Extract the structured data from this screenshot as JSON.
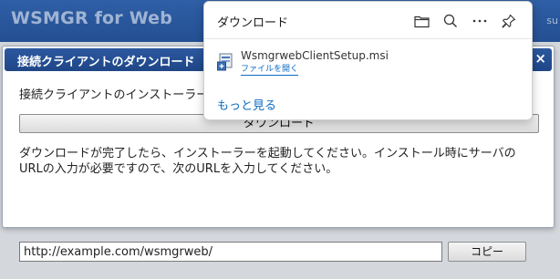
{
  "app": {
    "title": "WSMGR for Web",
    "header_right": "su"
  },
  "dialog": {
    "title": "接続クライアントのダウンロード",
    "close_glyph": "×",
    "intro": "接続クライアントのインストーラー",
    "download_label": "ダウンロード",
    "instruction": "ダウンロードが完了したら、インストーラーを起動してください。インストール時にサーバのURLの入力が必要ですので、次のURLを入力してください。",
    "url_value": "http://example.com/wsmgrweb/",
    "copy_label": "コピー"
  },
  "downloads": {
    "title": "ダウンロード",
    "icons": [
      "folder-icon",
      "search-icon",
      "more-icon",
      "pin-icon"
    ],
    "file_name": "WsmgrwebClientSetup.msi",
    "open_file_label": "ファイルを開く",
    "see_more_label": "もっと見る"
  },
  "colors": {
    "header_blue": "#2f5fa6",
    "dialog_title_blue": "#244f92",
    "link_blue": "#0d6bc4"
  }
}
